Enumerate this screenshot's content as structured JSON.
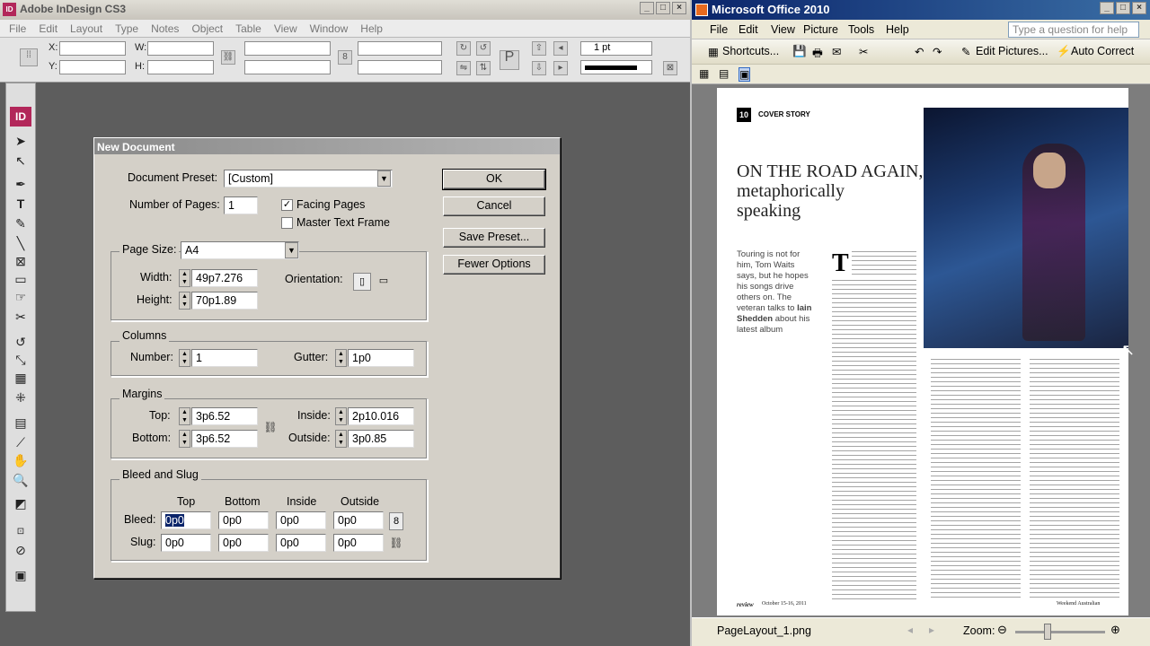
{
  "indesign": {
    "title": "Adobe InDesign CS3",
    "logo": "ID",
    "menu": [
      "File",
      "Edit",
      "Layout",
      "Type",
      "Notes",
      "Object",
      "Table",
      "View",
      "Window",
      "Help"
    ],
    "control": {
      "x_label": "X:",
      "y_label": "Y:",
      "w_label": "W:",
      "h_label": "H:",
      "stroke_weight": "1 pt"
    }
  },
  "dialog": {
    "title": "New Document",
    "preset_label": "Document Preset:",
    "preset_value": "[Custom]",
    "pages_label": "Number of Pages:",
    "pages_value": "1",
    "facing_pages_label": "Facing Pages",
    "facing_pages_checked": true,
    "master_text_label": "Master Text Frame",
    "master_text_checked": false,
    "page_size": {
      "title": "Page Size:",
      "value": "A4",
      "width_label": "Width:",
      "width_value": "49p7.276",
      "height_label": "Height:",
      "height_value": "70p1.89",
      "orientation_label": "Orientation:"
    },
    "columns": {
      "title": "Columns",
      "number_label": "Number:",
      "number_value": "1",
      "gutter_label": "Gutter:",
      "gutter_value": "1p0"
    },
    "margins": {
      "title": "Margins",
      "top_label": "Top:",
      "top_value": "3p6.52",
      "bottom_label": "Bottom:",
      "bottom_value": "3p6.52",
      "inside_label": "Inside:",
      "inside_value": "2p10.016",
      "outside_label": "Outside:",
      "outside_value": "3p0.85"
    },
    "bleed": {
      "title": "Bleed and Slug",
      "col_top": "Top",
      "col_bottom": "Bottom",
      "col_inside": "Inside",
      "col_outside": "Outside",
      "bleed_label": "Bleed:",
      "slug_label": "Slug:",
      "bleed_top": "0p0",
      "bleed_bottom": "0p0",
      "bleed_inside": "0p0",
      "bleed_outside": "0p0",
      "slug_top": "0p0",
      "slug_bottom": "0p0",
      "slug_inside": "0p0",
      "slug_outside": "0p0"
    },
    "buttons": {
      "ok": "OK",
      "cancel": "Cancel",
      "save_preset": "Save Preset...",
      "fewer_options": "Fewer Options"
    }
  },
  "office": {
    "title": "Microsoft Office 2010",
    "menu": [
      "File",
      "Edit",
      "View",
      "Picture",
      "Tools",
      "Help"
    ],
    "help_placeholder": "Type a question for help",
    "toolbar": {
      "shortcuts": "Shortcuts...",
      "edit_pictures": "Edit Pictures...",
      "auto_correct": "Auto Correct"
    },
    "status": {
      "filename": "PageLayout_1.png",
      "zoom_label": "Zoom:"
    },
    "article": {
      "page_no": "10",
      "section": "COVER STORY",
      "headline_1": "ON THE ROAD AGAIN,",
      "headline_2": "metaphorically",
      "headline_3": "speaking",
      "deck": "Touring is not for him, Tom Waits says, but he hopes his songs drive others on. The veteran talks to",
      "author": "Iain Shedden",
      "deck_end": "about his latest album",
      "dropcap": "T",
      "footer_left": "review",
      "footer_date": "October 15-16, 2011",
      "footer_right": "Weekend Australian"
    }
  }
}
